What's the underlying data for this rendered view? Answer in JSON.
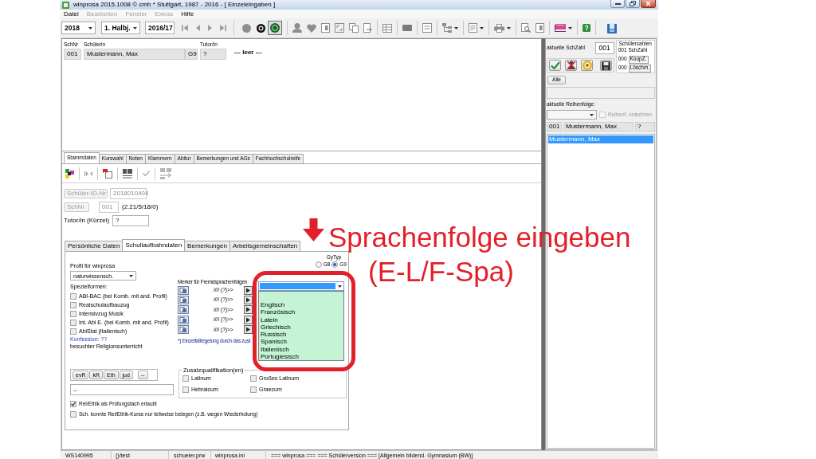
{
  "window": {
    "title": "winprosa 2015.1008 © cmh * Stuttgart, 1987 - 2016 - [ Einzeleingaben ]"
  },
  "menu": [
    {
      "label": "Datei",
      "disabled": false
    },
    {
      "label": "Bearbeiten",
      "disabled": true
    },
    {
      "label": "Fenster",
      "disabled": true
    },
    {
      "label": "Extras",
      "disabled": true
    },
    {
      "label": "Hilfe",
      "disabled": false
    }
  ],
  "toolbar": {
    "year": "2018",
    "term": "1. Halbj.",
    "school_year": "2016/17",
    "view_modes": [
      {
        "kind": "dot",
        "selected": false
      },
      {
        "kind": "ring",
        "selected": false
      },
      {
        "kind": "target",
        "selected": true
      }
    ]
  },
  "student_list": {
    "columns": [
      {
        "label": "SchNr",
        "value": "001"
      },
      {
        "label": "Schülerin",
        "value": "Mustermann, Max"
      },
      {
        "value": "G9"
      },
      {
        "label": "Tutor/in",
        "value": "?"
      }
    ],
    "note": "--- leer ---"
  },
  "tabs": [
    {
      "label": "Stammdaten",
      "selected": true
    },
    {
      "label": "Kurswahl",
      "selected": false
    },
    {
      "label": "Noten",
      "selected": false
    },
    {
      "label": "Klammern",
      "selected": false
    },
    {
      "label": "Abitur",
      "selected": false
    },
    {
      "label": "Bemerkungen und AGs",
      "selected": false
    },
    {
      "label": "Fachhochschulreife",
      "selected": false
    }
  ],
  "master_data": {
    "id": {
      "button": "Schüler-ID-Nr",
      "value": "2018010404",
      "disabled": true
    },
    "number": {
      "button": "SchNr",
      "value": "001",
      "code": "(2.21/5/18/0)",
      "disabled": true
    },
    "tutor": {
      "label": "Tutor/in (Kürzel)",
      "value": "?"
    }
  },
  "detail_tabs": [
    {
      "label": "Persönliche Daten",
      "selected": false
    },
    {
      "label": "Schullaufbahndaten",
      "selected": true
    },
    {
      "label": "Bemerkungen",
      "selected": false
    },
    {
      "label": "Arbeitsgemeinschaften",
      "selected": false
    }
  ],
  "school_career": {
    "profile_label": "Profil für winprosa",
    "profile_value": "naturwissensch.",
    "special_label": "Spezielformen:",
    "special_forms": [
      {
        "label": "ABI-BAC (bei Komb. mit and. Profil)",
        "checked": false
      },
      {
        "label": "Realschulaufbauzug",
        "checked": false
      },
      {
        "label": "Intensivzug Musik",
        "checked": false
      },
      {
        "label": "Int. Abi E. (bei Komb. mit and. Profil)",
        "checked": false
      },
      {
        "label": "AbiStat (Italienisch)",
        "checked": false
      }
    ],
    "confession": "Konfession: ??",
    "religion_label": "besuchter Religionsunterricht",
    "religion_buttons": [
      "evR",
      "kR",
      "Eth",
      "jud",
      "--"
    ],
    "religion_value": "--",
    "options": [
      {
        "label": "Rel/Ethik als Prüfungsfach erlaubt",
        "checked": true
      },
      {
        "label": "Sch. konnte Rel/Ethik-Kurse nur teilweise belegen (z.B. wegen Wiederholung)",
        "checked": false
      }
    ],
    "gytyp": {
      "label": "GyTyp",
      "options": [
        {
          "label": "G8",
          "selected": false
        },
        {
          "label": "G9",
          "selected": true
        }
      ]
    },
    "language_markers": {
      "title": "Merker für Fremdsprachenfolgen",
      "rows": [
        "//// (?)>>",
        "//// (?)>>",
        "//// (?)>>",
        "//// (?)>>",
        "//// (?)>>"
      ],
      "footnote": "*) Einzelfallregelung durch das zust"
    },
    "language_dropdown": {
      "expanded": true,
      "options": [
        "Englisch",
        "Französisch",
        "Latein",
        "Griechisch",
        "Russisch",
        "Spanisch",
        "Italienisch",
        "Portugiesisch"
      ]
    },
    "qualifications": {
      "title": "Zusatzqualifikation(en)",
      "items": [
        {
          "label": "Latinum",
          "checked": false
        },
        {
          "label": "Großes Latinum",
          "checked": false
        },
        {
          "label": "Hebraicum",
          "checked": false
        },
        {
          "label": "Graecum",
          "checked": false
        }
      ]
    }
  },
  "side_panel": {
    "count_label": "aktuelle SchZahl",
    "count_value": "001",
    "counts_title": "Schülerzahlen",
    "counts": [
      {
        "kind": "text",
        "count": "001",
        "name": "SchZahl"
      },
      {
        "kind": "button",
        "count": "000",
        "name": "KoopZ."
      },
      {
        "kind": "button",
        "count": "000",
        "name": "Löschm."
      }
    ],
    "all_button": "Alle",
    "order_label": "aktuelle Reihenfolge:",
    "reverse": {
      "label": "Reihenf. umkehren",
      "checked": false,
      "disabled": true
    },
    "current": [
      "001",
      "Mustermann, Max",
      "?"
    ],
    "list": [
      {
        "label": "Mustermann, Max",
        "selected": true
      }
    ]
  },
  "status_bar": [
    "WS140995",
    "()/test",
    "schueler.prw",
    "winprosa.ini",
    "=== winprosa === === Schülerversion === [Allgemein bildend. Gymnasium (BW)]"
  ],
  "annotation": {
    "title": "Sprachenfolge eingeben",
    "subtitle": "(E-L/F-Spa)"
  }
}
